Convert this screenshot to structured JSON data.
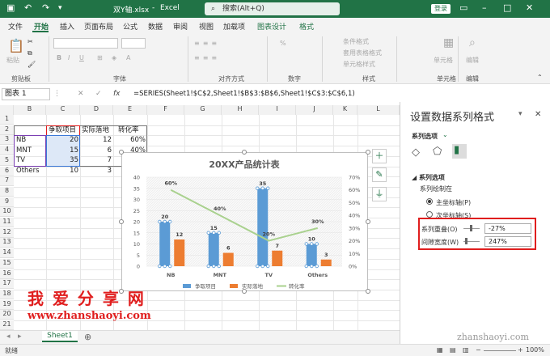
{
  "titlebar": {
    "filename": "双Y轴.xlsx",
    "app": "Excel",
    "search": "搜索(Alt+Q)",
    "login": "登录",
    "share": "共享"
  },
  "tabs": [
    "文件",
    "开始",
    "插入",
    "页面布局",
    "公式",
    "数据",
    "审阅",
    "视图",
    "加载项",
    "图表设计",
    "格式"
  ],
  "ribbon": {
    "groups": [
      "剪贴板",
      "字体",
      "对齐方式",
      "数字",
      "样式",
      "单元格",
      "编辑"
    ],
    "paste": "粘贴",
    "styles": [
      "条件格式",
      "套用表格格式",
      "单元格样式"
    ],
    "cells": "单元格",
    "edit": "编辑"
  },
  "formula_bar": {
    "name_box": "图表 1",
    "fx": "fx",
    "formula": "=SERIES(Sheet1!$C$2,Sheet1!$B$3:$B$6,Sheet1!$C$3:$C$6,1)"
  },
  "columns": [
    "B",
    "C",
    "D",
    "E",
    "F",
    "G",
    "H",
    "I",
    "J",
    "K",
    "L"
  ],
  "rows": [
    "1",
    "2",
    "3",
    "4",
    "5",
    "6",
    "7",
    "8",
    "9",
    "10",
    "11",
    "12",
    "13",
    "14",
    "15",
    "16",
    "17",
    "18",
    "19",
    "20",
    "21"
  ],
  "table": {
    "headers": [
      "争取项目",
      "实际落地",
      "转化率"
    ],
    "rows": [
      {
        "name": "NB",
        "a": "20",
        "b": "12",
        "c": "60%"
      },
      {
        "name": "MNT",
        "a": "15",
        "b": "6",
        "c": "40%"
      },
      {
        "name": "TV",
        "a": "35",
        "b": "7",
        "c": "20%"
      },
      {
        "name": "Others",
        "a": "10",
        "b": "3",
        "c": "30%"
      }
    ]
  },
  "chart_data": {
    "type": "bar",
    "title": "20XX产品统计表",
    "categories": [
      "NB",
      "MNT",
      "TV",
      "Others"
    ],
    "series": [
      {
        "name": "争取项目",
        "type": "bar",
        "axis": "left",
        "values": [
          20,
          15,
          35,
          10
        ],
        "color": "#5b9bd5"
      },
      {
        "name": "实际落地",
        "type": "bar",
        "axis": "left",
        "values": [
          12,
          6,
          7,
          3
        ],
        "color": "#ed7d31"
      },
      {
        "name": "转化率",
        "type": "line",
        "axis": "right",
        "values": [
          60,
          40,
          20,
          30
        ],
        "labels": [
          "60%",
          "40%",
          "20%",
          "30%"
        ],
        "color": "#a9d18e"
      }
    ],
    "y_left": {
      "min": 0,
      "max": 40,
      "ticks": [
        "0",
        "5",
        "10",
        "15",
        "20",
        "25",
        "30",
        "35",
        "40"
      ]
    },
    "y_right": {
      "min": 0,
      "max": 70,
      "ticks": [
        "0%",
        "10%",
        "20%",
        "30%",
        "40%",
        "50%",
        "60%",
        "70%"
      ]
    },
    "legend_position": "bottom"
  },
  "pane": {
    "title": "设置数据系列格式",
    "options": "系列选项",
    "section": "系列选项",
    "plot_on": "系列绘制在",
    "primary": "主坐标轴(P)",
    "secondary": "次坐标轴(S)",
    "overlap_label": "系列重叠(O)",
    "overlap_value": "-27%",
    "gap_label": "间隙宽度(W)",
    "gap_value": "247%"
  },
  "sheet": {
    "tab": "Sheet1"
  },
  "status": {
    "mode": "就绪",
    "zoom": "100%"
  },
  "watermark": {
    "title": "我 爱 分 享 网",
    "url": "www.zhanshaoyi.com",
    "corner": "zhanshaoyi.com"
  }
}
